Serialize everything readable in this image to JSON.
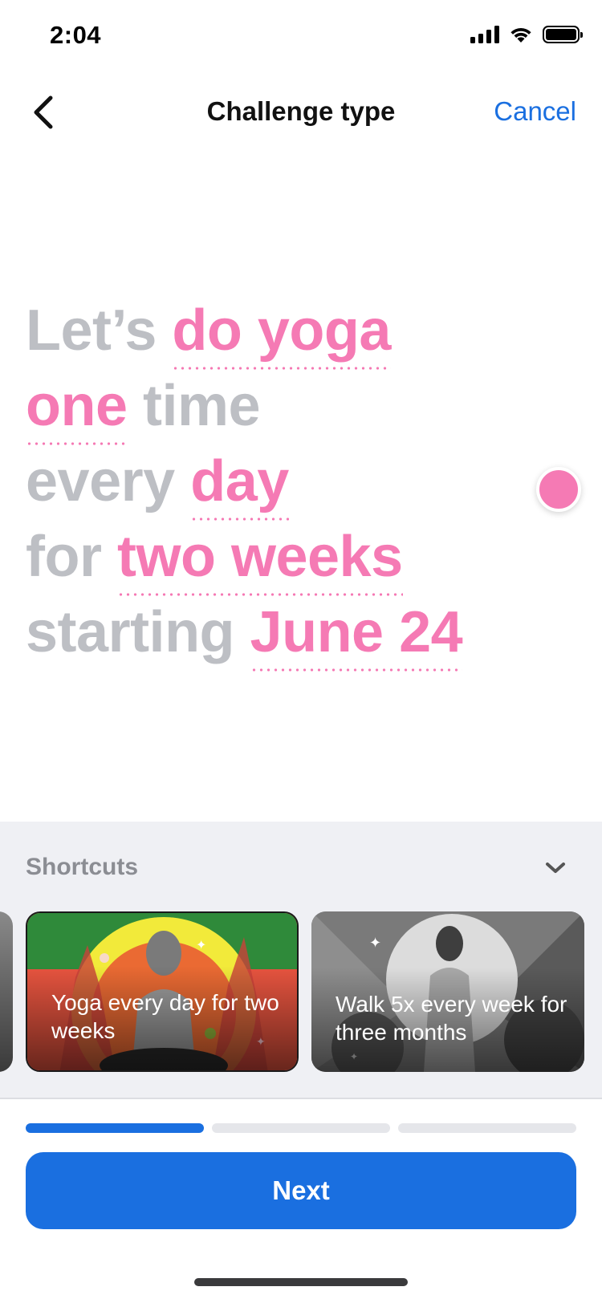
{
  "status_bar": {
    "time": "2:04"
  },
  "nav": {
    "title": "Challenge type",
    "cancel_label": "Cancel",
    "back_icon": "chevron-left-icon"
  },
  "sentence": {
    "lets": "Let’s",
    "activity": "do yoga",
    "count": "one",
    "time_word": "time",
    "every": "every",
    "frequency": "day",
    "for_word": "for",
    "duration": "two weeks",
    "starting_word": "starting",
    "start_date": "June 24"
  },
  "shortcuts": {
    "title": "Shortcuts",
    "toggle_icon": "chevron-down-icon",
    "cards": [
      {
        "label": "Yoga every day for two weeks"
      },
      {
        "label": "Walk 5x every week for three months"
      }
    ]
  },
  "progress": {
    "steps": 3,
    "current": 1
  },
  "next_label": "Next",
  "colors": {
    "accent": "#1a6fe0",
    "token": "#f57ab4",
    "muted_text": "#bdbfc4",
    "panel_bg": "#eff0f4"
  }
}
